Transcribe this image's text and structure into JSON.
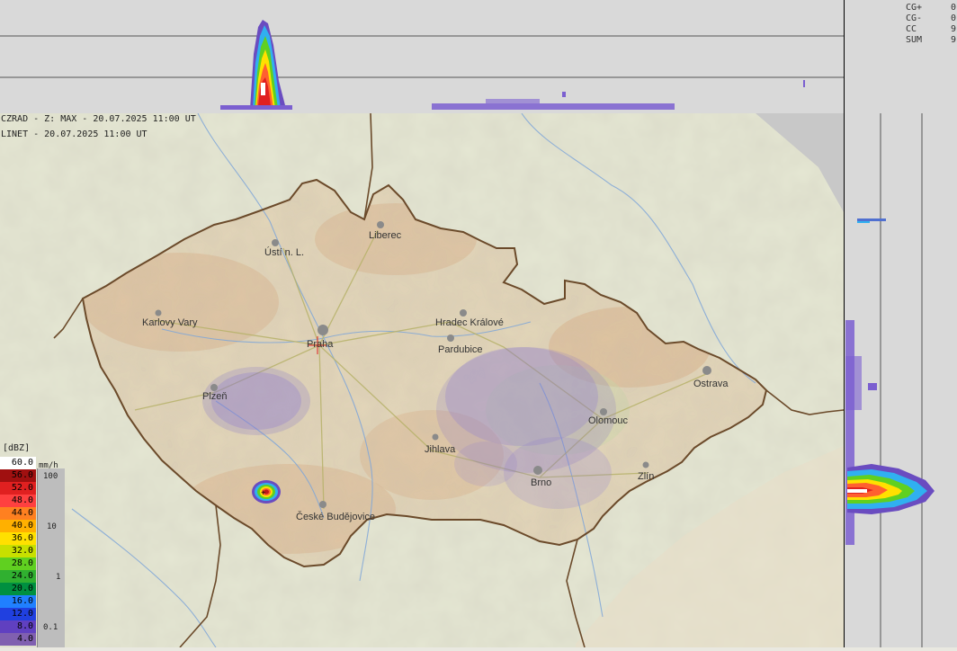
{
  "map_header": {
    "radar_line": "CZRAD - Z: MAX - 20.07.2025 11:00 UT",
    "linet_line": "LINET - 20.07.2025 11:00 UT"
  },
  "lightning_stats": [
    {
      "label": "CG+",
      "value": "0"
    },
    {
      "label": "CG-",
      "value": "0"
    },
    {
      "label": "CC",
      "value": "9"
    },
    {
      "label": "SUM",
      "value": "9"
    }
  ],
  "legend": {
    "title": "[dBZ]",
    "unit": "mm/h",
    "steps": [
      {
        "value": "60.0",
        "color": "#ffffff"
      },
      {
        "value": "56.0",
        "color": "#a01010"
      },
      {
        "value": "52.0",
        "color": "#e02020"
      },
      {
        "value": "48.0",
        "color": "#ff4040"
      },
      {
        "value": "44.0",
        "color": "#ff8020"
      },
      {
        "value": "40.0",
        "color": "#ffb000"
      },
      {
        "value": "36.0",
        "color": "#ffe000"
      },
      {
        "value": "32.0",
        "color": "#c8e000"
      },
      {
        "value": "28.0",
        "color": "#60d020"
      },
      {
        "value": "24.0",
        "color": "#30b030"
      },
      {
        "value": "20.0",
        "color": "#009040"
      },
      {
        "value": "16.0",
        "color": "#2080ff"
      },
      {
        "value": "12.0",
        "color": "#2040e0"
      },
      {
        "value": "8.0",
        "color": "#6040c0"
      },
      {
        "value": "4.0",
        "color": "#8060b0"
      }
    ],
    "rain_ticks": [
      "100",
      "10",
      "1",
      "0.1"
    ]
  },
  "cities": [
    {
      "name": "Liberec"
    },
    {
      "name": "Ústí n. L."
    },
    {
      "name": "Karlovy Vary"
    },
    {
      "name": "Praha"
    },
    {
      "name": "Hradec Králové"
    },
    {
      "name": "Pardubice"
    },
    {
      "name": "Ostrava"
    },
    {
      "name": "Plzeň"
    },
    {
      "name": "Olomouc"
    },
    {
      "name": "Jihlava"
    },
    {
      "name": "Brno"
    },
    {
      "name": "Zlín"
    },
    {
      "name": "České Budějovice"
    }
  ],
  "colors": {
    "panel": "#d9d9d9",
    "radar_weak": "#8f7fd0",
    "border": "#6b4a2a"
  }
}
